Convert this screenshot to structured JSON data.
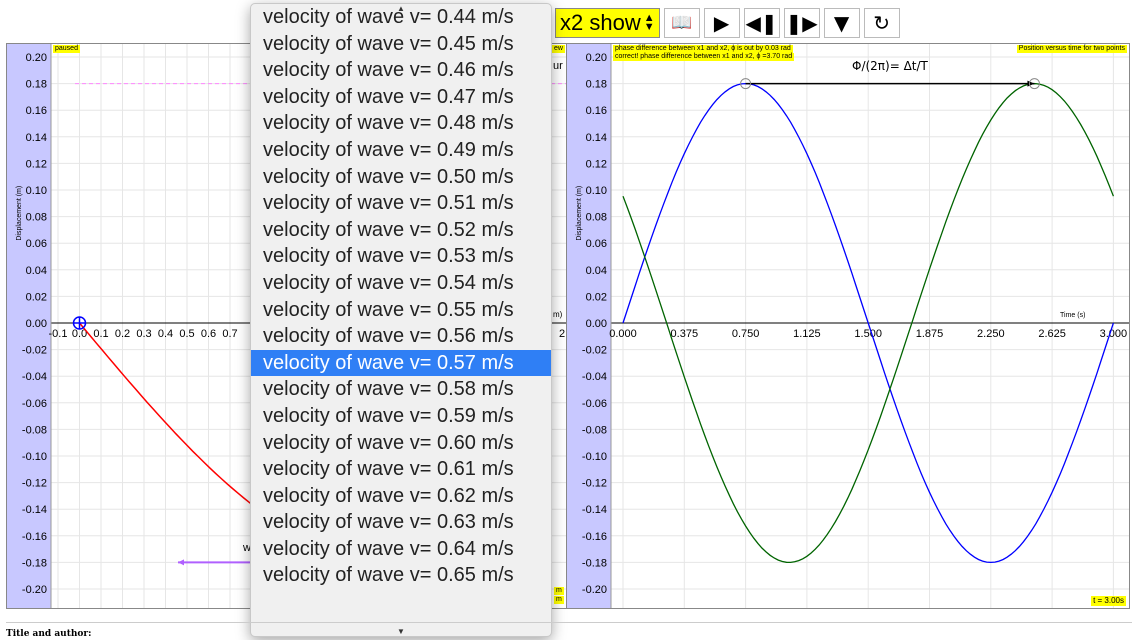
{
  "toolbar": {
    "select_label": "x2 show",
    "book_icon": "book-icon",
    "play_icon": "play-icon",
    "step_back_icon": "step-back-icon",
    "step_forward_icon": "step-forward-icon",
    "collapse_icon": "collapse-icon",
    "reset_icon": "reset-icon"
  },
  "dropdown": {
    "items": [
      "velocity of wave v= 0.44 m/s",
      "velocity of wave v= 0.45 m/s",
      "velocity of wave v= 0.46 m/s",
      "velocity of wave v= 0.47 m/s",
      "velocity of wave v= 0.48 m/s",
      "velocity of wave v= 0.49 m/s",
      "velocity of wave v= 0.50 m/s",
      "velocity of wave v= 0.51 m/s",
      "velocity of wave v= 0.52 m/s",
      "velocity of wave v= 0.53 m/s",
      "velocity of wave v= 0.54 m/s",
      "velocity of wave v= 0.55 m/s",
      "velocity of wave v= 0.56 m/s",
      "velocity of wave v= 0.57 m/s",
      "velocity of wave v= 0.58 m/s",
      "velocity of wave v= 0.59 m/s",
      "velocity of wave v= 0.60 m/s",
      "velocity of wave v= 0.61 m/s",
      "velocity of wave v= 0.62 m/s",
      "velocity of wave v= 0.63 m/s",
      "velocity of wave v= 0.64 m/s",
      "velocity of wave v= 0.65 m/s"
    ],
    "selected_index": 13,
    "selected_color": "#2f7ff5"
  },
  "left_graph": {
    "tag": "paused",
    "ylabel": "Displacement (m)",
    "x_ticks": [
      "-0.1",
      "0.0",
      "0.1",
      "0.2",
      "0.3",
      "0.4",
      "0.5",
      "0.6",
      "0.7"
    ],
    "y_ticks": [
      "0.20",
      "0.18",
      "0.16",
      "0.14",
      "0.12",
      "0.10",
      "0.08",
      "0.06",
      "0.04",
      "0.02",
      "0.00",
      "-0.02",
      "-0.04",
      "-0.06",
      "-0.08",
      "-0.10",
      "-0.12",
      "-0.14",
      "-0.16",
      "-0.18",
      "-0.20"
    ],
    "fragment_right_top": "ew",
    "fragment_right_mid": "ur",
    "fragment_axis_unit": "m)",
    "fragment_axis_tick": "2.",
    "fragment_bottom_label": "w",
    "fragment_tag_bottom_1": "m",
    "fragment_tag_bottom_2": "m",
    "wave_color": "#ff0000"
  },
  "right_graph": {
    "tag_left_1": "phase difference between x1 and x2, ϕ is out by 0.03 rad",
    "tag_left_2": "correct! phase difference between x1 and x2, ϕ =3.70 rad",
    "tag_right": "Position versus time for two points",
    "formula": "Φ/(2π)= Δt/T",
    "ylabel": "Displacement (m)",
    "xlabel": "Time (s)",
    "x_ticks": [
      "0.000",
      "0.375",
      "0.750",
      "1.125",
      "1.500",
      "1.875",
      "2.250",
      "2.625",
      "3.000"
    ],
    "y_ticks": [
      "0.20",
      "0.18",
      "0.16",
      "0.14",
      "0.12",
      "0.10",
      "0.08",
      "0.06",
      "0.04",
      "0.02",
      "0.00",
      "-0.02",
      "-0.04",
      "-0.06",
      "-0.08",
      "-0.10",
      "-0.12",
      "-0.14",
      "-0.16",
      "-0.18",
      "-0.20"
    ],
    "time_badge": "t = 3.00s",
    "series_colors": [
      "#0000ff",
      "#006400"
    ]
  },
  "footer": {
    "title": "Title and author:"
  }
}
